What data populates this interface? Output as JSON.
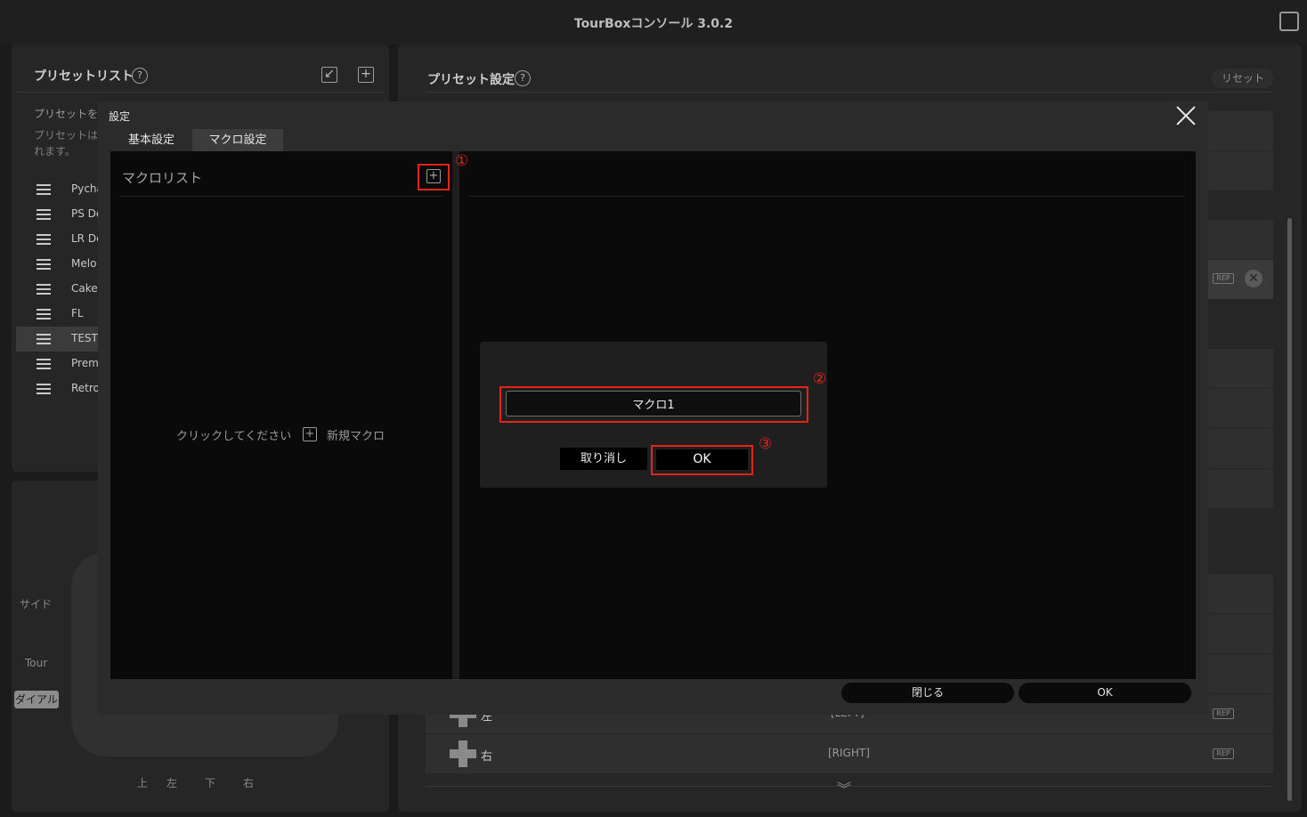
{
  "window": {
    "title": "TourBoxコンソール 3.0.2"
  },
  "preset_list": {
    "title": "プリセットリスト",
    "help": "?",
    "desc_line1": "プリセットを",
    "desc_line2": "プリセットは",
    "desc_line3": "れます。",
    "items": [
      {
        "label": "Pycha"
      },
      {
        "label": "PS De"
      },
      {
        "label": "LR De"
      },
      {
        "label": "Melo"
      },
      {
        "label": "Cake"
      },
      {
        "label": "FL"
      },
      {
        "label": "TEST"
      },
      {
        "label": "Prem"
      },
      {
        "label": "Retro"
      }
    ]
  },
  "device": {
    "label_side": "サイド",
    "label_tour": "Tour",
    "label_dial": "ダイアル",
    "label_up": "上",
    "label_left": "左",
    "label_down": "下",
    "label_right": "右"
  },
  "preset_settings": {
    "title": "プリセット設定",
    "help": "?",
    "reset_label": "リセット",
    "rep_badge": "REP",
    "remove_symbol": "✕",
    "rows": [
      {
        "name": "左",
        "key": "[LEFT]"
      },
      {
        "name": "右",
        "key": "[RIGHT]"
      }
    ],
    "more_symbol": "︾"
  },
  "settings_dialog": {
    "title": "設定",
    "tabs": [
      {
        "label": "基本設定"
      },
      {
        "label": "マクロ設定"
      }
    ],
    "macro_list_title": "マクロリスト",
    "add_symbol": "+",
    "hint_click": "クリックしてください",
    "hint_new_macro": "新規マクロ",
    "annotations": [
      "①",
      "②",
      "③"
    ],
    "name_dialog": {
      "input_value": "マクロ1",
      "cancel_label": "取り消し",
      "ok_label": "OK"
    },
    "close_label": "閉じる",
    "ok_label": "OK"
  },
  "colors": {
    "highlight": "#e8231a",
    "background": "#1b1b1b",
    "panel": "#262626"
  }
}
